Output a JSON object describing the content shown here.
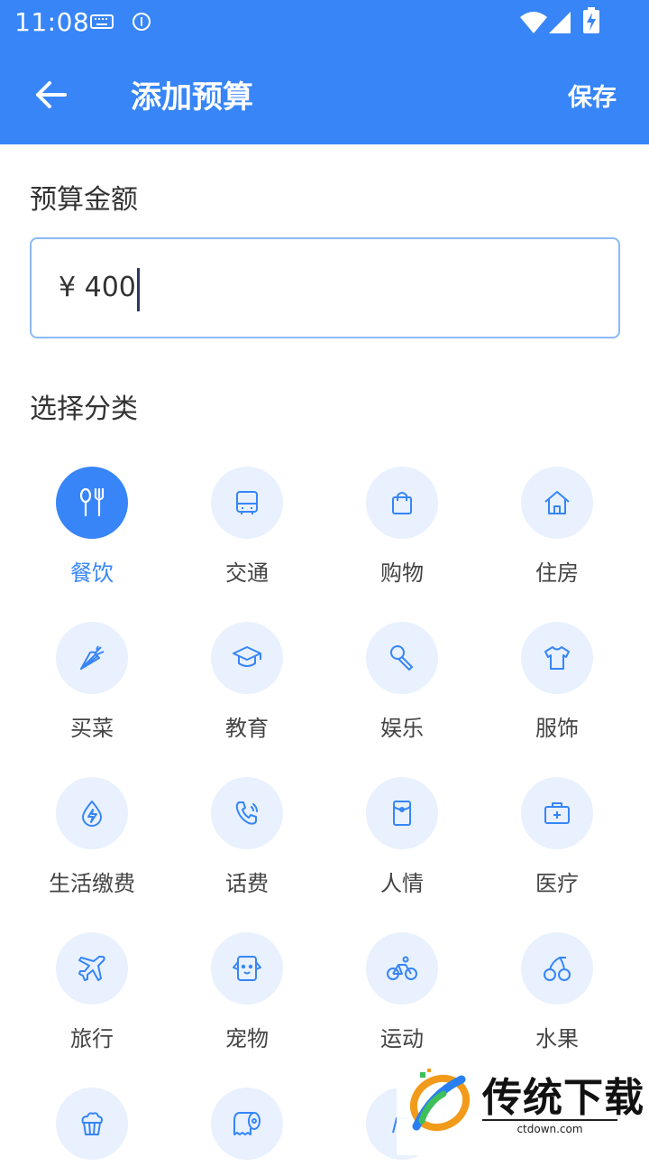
{
  "status_bar": {
    "time": "11:08"
  },
  "app_bar": {
    "title": "添加预算",
    "save_label": "保存"
  },
  "amount": {
    "label": "预算金额",
    "value": "¥ 400"
  },
  "category_section": {
    "label": "选择分类"
  },
  "categories": [
    {
      "label": "餐饮",
      "icon": "utensils-icon",
      "selected": true
    },
    {
      "label": "交通",
      "icon": "bus-icon"
    },
    {
      "label": "购物",
      "icon": "shopping-bag-icon"
    },
    {
      "label": "住房",
      "icon": "house-icon"
    },
    {
      "label": "买菜",
      "icon": "carrot-icon"
    },
    {
      "label": "教育",
      "icon": "graduation-cap-icon"
    },
    {
      "label": "娱乐",
      "icon": "microphone-icon"
    },
    {
      "label": "服饰",
      "icon": "tshirt-icon"
    },
    {
      "label": "生活缴费",
      "icon": "water-drop-bolt-icon"
    },
    {
      "label": "话费",
      "icon": "phone-icon"
    },
    {
      "label": "人情",
      "icon": "red-envelope-icon"
    },
    {
      "label": "医疗",
      "icon": "medical-kit-icon"
    },
    {
      "label": "旅行",
      "icon": "airplane-icon"
    },
    {
      "label": "宠物",
      "icon": "pet-dog-icon"
    },
    {
      "label": "运动",
      "icon": "bicycle-icon"
    },
    {
      "label": "水果",
      "icon": "cherries-icon"
    },
    {
      "label": "",
      "icon": "cupcake-icon"
    },
    {
      "label": "",
      "icon": "toilet-paper-icon"
    },
    {
      "label": "",
      "icon": "partial-icon"
    }
  ],
  "watermark": {
    "title": "传统下载",
    "url": "ctdown.com"
  },
  "colors": {
    "primary": "#3785f7",
    "chip_bg": "#e8f1fd",
    "text": "#333333"
  }
}
